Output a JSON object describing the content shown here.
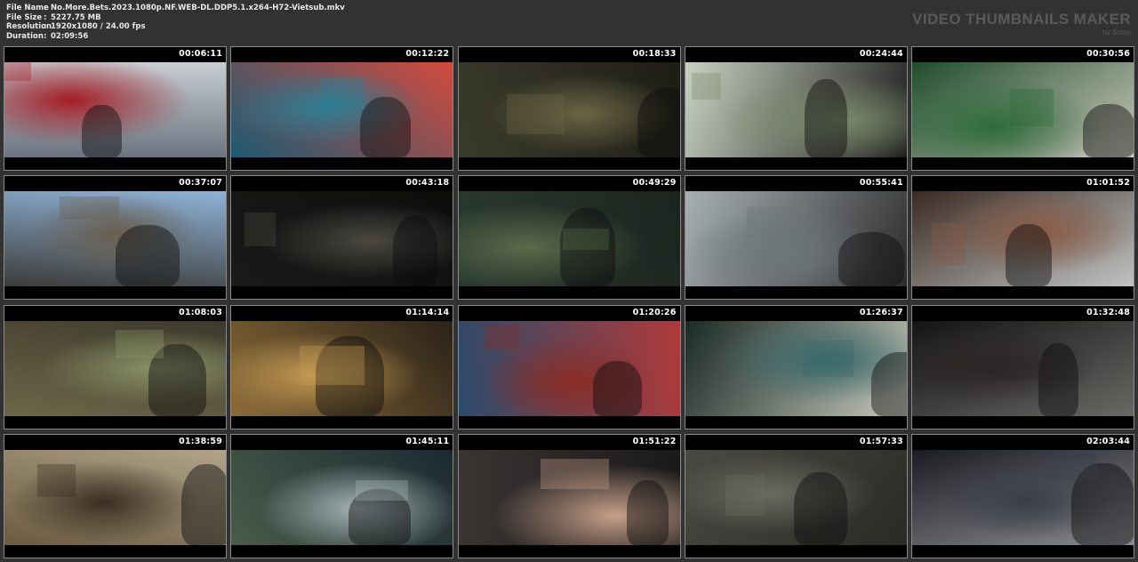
{
  "file_info": [
    {
      "label": "File Name",
      "value": "No.More.Bets.2023.1080p.NF.WEB-DL.DDP5.1.x264-H72-Vietsub.mkv"
    },
    {
      "label": "File Size",
      "value": "5227.75 MB"
    },
    {
      "label": "Resolution",
      "value": "1920x1080 / 24.00 fps"
    },
    {
      "label": "Duration",
      "value": "02:09:56"
    }
  ],
  "brand": {
    "title": "VIDEO THUMBNAILS MAKER",
    "subtitle": "by Scorp"
  },
  "thumbnails": [
    {
      "timestamp": "00:06:11",
      "scene_colors": [
        "#6b7480",
        "#a51d25",
        "#c9ced3"
      ]
    },
    {
      "timestamp": "00:12:22",
      "scene_colors": [
        "#1d5a73",
        "#2d7f96",
        "#d24a3e"
      ]
    },
    {
      "timestamp": "00:18:33",
      "scene_colors": [
        "#3a3a2c",
        "#6b6444",
        "#1d1d16"
      ]
    },
    {
      "timestamp": "00:24:44",
      "scene_colors": [
        "#c9d2c2",
        "#7a8a6a",
        "#1a1a1a"
      ]
    },
    {
      "timestamp": "00:30:56",
      "scene_colors": [
        "#1f4d2c",
        "#2f6b3a",
        "#cfcac0"
      ]
    },
    {
      "timestamp": "00:37:07",
      "scene_colors": [
        "#3c3c3a",
        "#6a5e4e",
        "#8fb3d8"
      ]
    },
    {
      "timestamp": "00:43:18",
      "scene_colors": [
        "#1a1a18",
        "#4a4a42",
        "#0d0d0c"
      ]
    },
    {
      "timestamp": "00:49:29",
      "scene_colors": [
        "#2a3a30",
        "#5a6a4a",
        "#1c241e"
      ]
    },
    {
      "timestamp": "00:55:41",
      "scene_colors": [
        "#a8b0b4",
        "#6e767a",
        "#2c2c2c"
      ]
    },
    {
      "timestamp": "01:01:52",
      "scene_colors": [
        "#3a2a22",
        "#8a5a44",
        "#c0c4c4"
      ]
    },
    {
      "timestamp": "01:08:03",
      "scene_colors": [
        "#6e6648",
        "#8a9468",
        "#3c3a2c"
      ]
    },
    {
      "timestamp": "01:14:14",
      "scene_colors": [
        "#8a6a38",
        "#c49a54",
        "#2a2218"
      ]
    },
    {
      "timestamp": "01:20:26",
      "scene_colors": [
        "#2c4a6a",
        "#8a2c24",
        "#b03a3a"
      ]
    },
    {
      "timestamp": "01:26:37",
      "scene_colors": [
        "#1a2a24",
        "#3a6a6a",
        "#c8cac0"
      ]
    },
    {
      "timestamp": "01:32:48",
      "scene_colors": [
        "#141414",
        "#2a2624",
        "#6a6864"
      ]
    },
    {
      "timestamp": "01:38:59",
      "scene_colors": [
        "#6a5a40",
        "#3a2e22",
        "#b0a48a"
      ]
    },
    {
      "timestamp": "01:45:11",
      "scene_colors": [
        "#4a5a4a",
        "#a8b4b8",
        "#1c2a30"
      ]
    },
    {
      "timestamp": "01:51:22",
      "scene_colors": [
        "#3a3432",
        "#c8a08a",
        "#1a1a1a"
      ]
    },
    {
      "timestamp": "01:57:33",
      "scene_colors": [
        "#4a4a44",
        "#6a6a60",
        "#2a2a26"
      ]
    },
    {
      "timestamp": "02:03:44",
      "scene_colors": [
        "#1a1c22",
        "#3a3e48",
        "#8a8c90"
      ]
    }
  ]
}
